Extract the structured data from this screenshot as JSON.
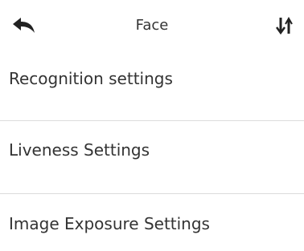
{
  "header": {
    "title": "Face",
    "back_icon": "back-arrow-icon",
    "sort_icon": "sort-icon"
  },
  "menu": {
    "items": [
      {
        "label": "Recognition settings"
      },
      {
        "label": "Liveness Settings"
      },
      {
        "label": "Image Exposure Settings"
      }
    ]
  },
  "colors": {
    "text": "#333333",
    "divider": "#dcdcdc",
    "background": "#ffffff"
  }
}
